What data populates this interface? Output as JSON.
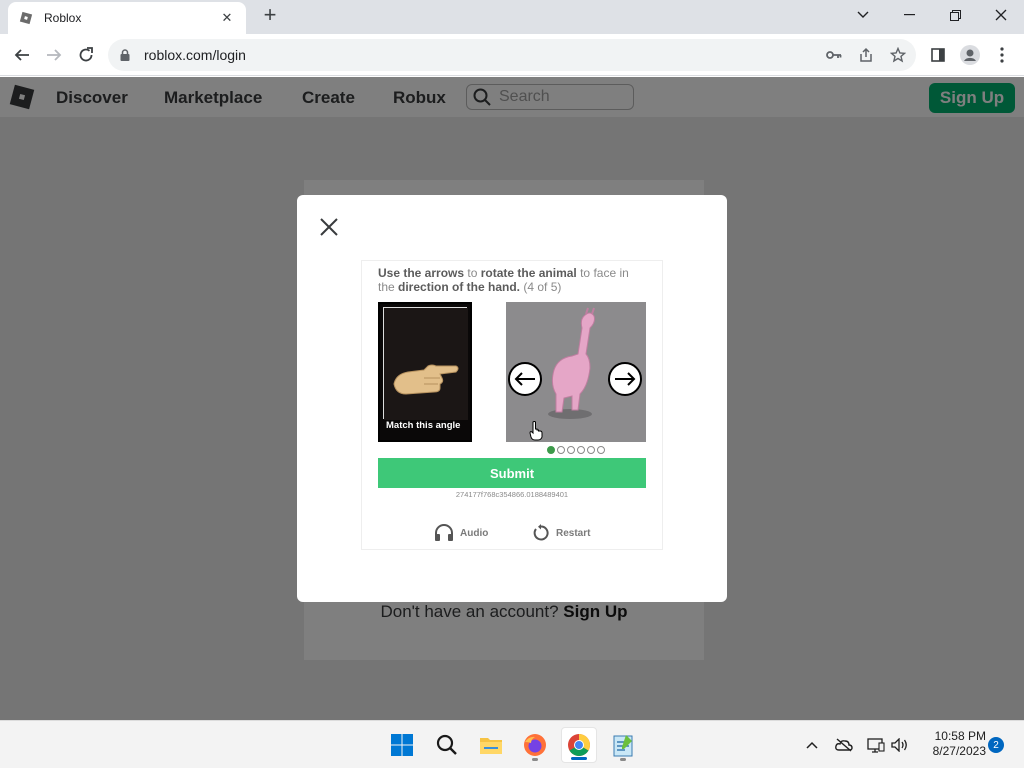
{
  "browser": {
    "tab": {
      "title": "Roblox",
      "favicon": "roblox-favicon"
    },
    "url": "roblox.com/login",
    "window_controls": [
      "minimize",
      "restore",
      "close"
    ]
  },
  "roblox": {
    "nav": [
      "Discover",
      "Marketplace",
      "Create",
      "Robux"
    ],
    "search_placeholder": "Search",
    "signup_label": "Sign Up",
    "no_account_text": "Don't have an account?",
    "no_account_link": "Sign Up"
  },
  "captcha": {
    "instruction": {
      "p1": "Use the arrows",
      "p2": " to ",
      "p3": "rotate the animal",
      "p4": " to face in the ",
      "p5": "direction of the hand.",
      "p6": " (4 of 5)"
    },
    "reference_label": "Match this angle",
    "submit_label": "Submit",
    "session_id": "274177f768c354866.0188489401",
    "audio_label": "Audio",
    "restart_label": "Restart",
    "dots": {
      "total": 6,
      "active": 0
    }
  },
  "taskbar": {
    "time": "10:58 PM",
    "date": "8/27/2023",
    "notifications": "2",
    "apps": [
      "windows-start",
      "search",
      "file-explorer",
      "firefox",
      "chrome",
      "notepad"
    ]
  },
  "colors": {
    "accent_green": "#00b06f",
    "submit_green": "#3ec878",
    "chrome_tab_bar": "#dee1e6"
  }
}
